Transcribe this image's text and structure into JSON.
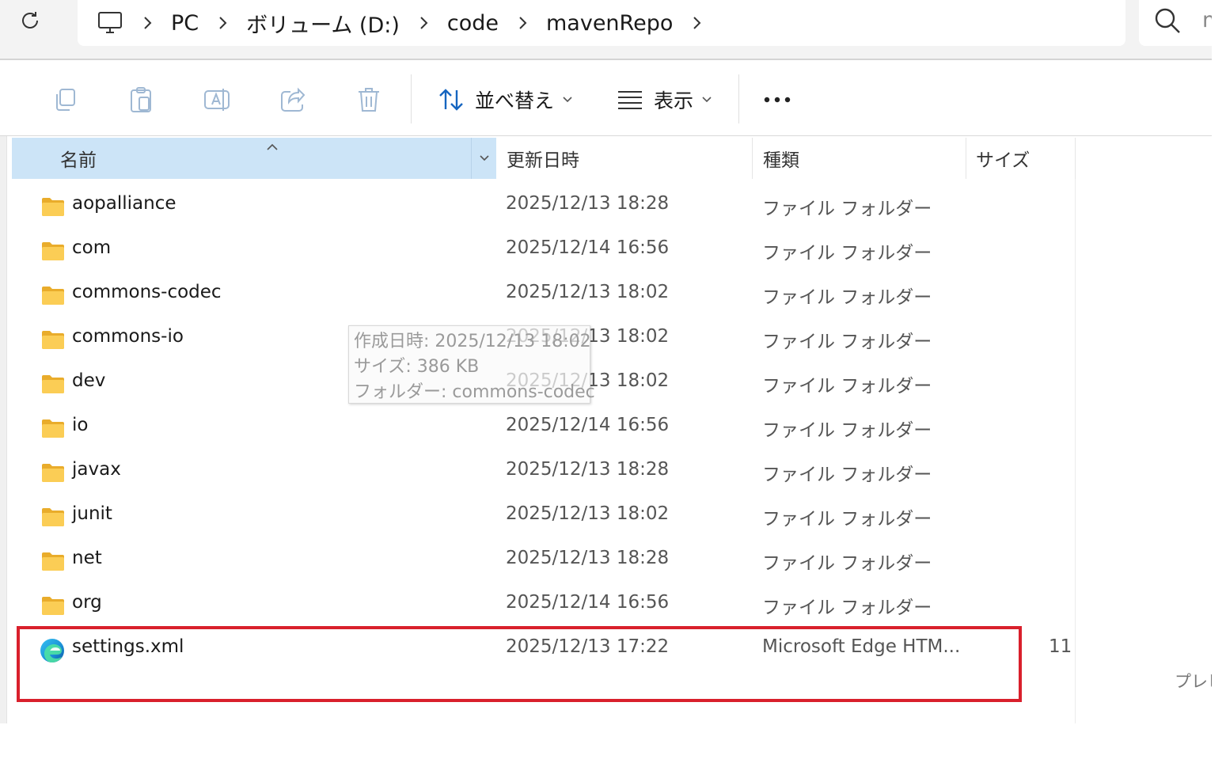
{
  "breadcrumb": {
    "items": [
      "PC",
      "ボリューム (D:)",
      "code",
      "mavenRepo"
    ]
  },
  "search": {
    "text": "m"
  },
  "toolbar": {
    "sort_label": "並べ替え",
    "view_label": "表示"
  },
  "columns": {
    "name": "名前",
    "modified": "更新日時",
    "type": "種類",
    "size": "サイズ"
  },
  "files": [
    {
      "name": "aopalliance",
      "modified": "2025/12/13 18:28",
      "type": "ファイル フォルダー",
      "size": "",
      "icon": "folder-icon"
    },
    {
      "name": "com",
      "modified": "2025/12/14 16:56",
      "type": "ファイル フォルダー",
      "size": "",
      "icon": "folder-icon"
    },
    {
      "name": "commons-codec",
      "modified": "2025/12/13 18:02",
      "type": "ファイル フォルダー",
      "size": "",
      "icon": "folder-icon"
    },
    {
      "name": "commons-io",
      "modified": "2025/12/13 18:02",
      "type": "ファイル フォルダー",
      "size": "",
      "icon": "folder-icon"
    },
    {
      "name": "dev",
      "modified": "2025/12/13 18:02",
      "type": "ファイル フォルダー",
      "size": "",
      "icon": "folder-icon"
    },
    {
      "name": "io",
      "modified": "2025/12/14 16:56",
      "type": "ファイル フォルダー",
      "size": "",
      "icon": "folder-icon"
    },
    {
      "name": "javax",
      "modified": "2025/12/13 18:28",
      "type": "ファイル フォルダー",
      "size": "",
      "icon": "folder-icon"
    },
    {
      "name": "junit",
      "modified": "2025/12/13 18:02",
      "type": "ファイル フォルダー",
      "size": "",
      "icon": "folder-icon"
    },
    {
      "name": "net",
      "modified": "2025/12/13 18:28",
      "type": "ファイル フォルダー",
      "size": "",
      "icon": "folder-icon"
    },
    {
      "name": "org",
      "modified": "2025/12/14 16:56",
      "type": "ファイル フォルダー",
      "size": "",
      "icon": "folder-icon"
    },
    {
      "name": "settings.xml",
      "modified": "2025/12/13 17:22",
      "type": "Microsoft Edge HTM...",
      "size": "11",
      "icon": "edge-icon"
    }
  ],
  "tooltip": {
    "created": "作成日時: 2025/12/13 18:02",
    "size": "サイズ: 386 KB",
    "folders": "フォルダー: commons-codec"
  },
  "preview_label": "プレビ",
  "colors": {
    "highlight_border": "#d9202c",
    "header_selected_bg": "#cce4f7",
    "folder": "#f8c84a"
  }
}
